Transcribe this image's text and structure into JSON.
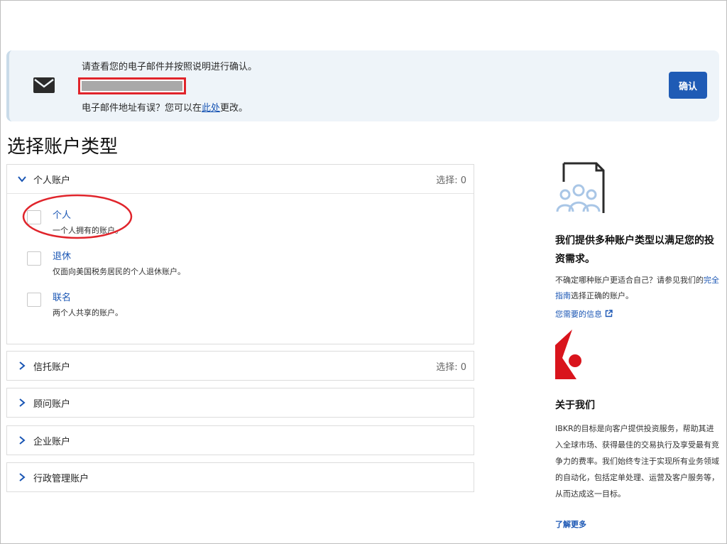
{
  "banner": {
    "line1": "请查看您的电子邮件并按照说明进行确认。",
    "line3_prefix": "电子邮件地址有误？您可以在",
    "line3_link": "此处",
    "line3_suffix": "更改。",
    "confirm_label": "确认"
  },
  "page": {
    "title": "选择账户类型"
  },
  "sections": [
    {
      "label": "个人账户",
      "count": "选择: 0",
      "options": [
        {
          "title": "个人",
          "desc": "一个人拥有的账户。"
        },
        {
          "title": "退休",
          "desc": "仅面向美国税务居民的个人退休账户。"
        },
        {
          "title": "联名",
          "desc": "两个人共享的账户。"
        }
      ]
    },
    {
      "label": "信托账户",
      "count": "选择: 0"
    },
    {
      "label": "顾问账户"
    },
    {
      "label": "企业账户"
    },
    {
      "label": "行政管理账户"
    }
  ],
  "side": {
    "heading": "我们提供多种账户类型以满足您的投资需求。",
    "para_prefix": "不确定哪种账户更适合自己？请参见我们的",
    "para_link": "完全指南",
    "para_suffix": "选择正确的账户。",
    "info_link": "您需要的信息",
    "about_heading": "关于我们",
    "about_text": "IBKR的目标是向客户提供投资服务，帮助其进入全球市场、获得最佳的交易执行及享受最有竞争力的费率。我们始终专注于实现所有业务领域的自动化，包括定单处理、运营及客户服务等，从而达成这一目标。",
    "more_link": "了解更多"
  },
  "colors": {
    "accent": "#1f5bb5",
    "link": "#1a56b4",
    "highlight": "#e0242b",
    "logo": "#d9141c"
  },
  "icons": [
    "mail-icon",
    "chevron-down-icon",
    "chevron-right-icon",
    "external-link-icon",
    "people-document-icon",
    "ibkr-logo"
  ]
}
